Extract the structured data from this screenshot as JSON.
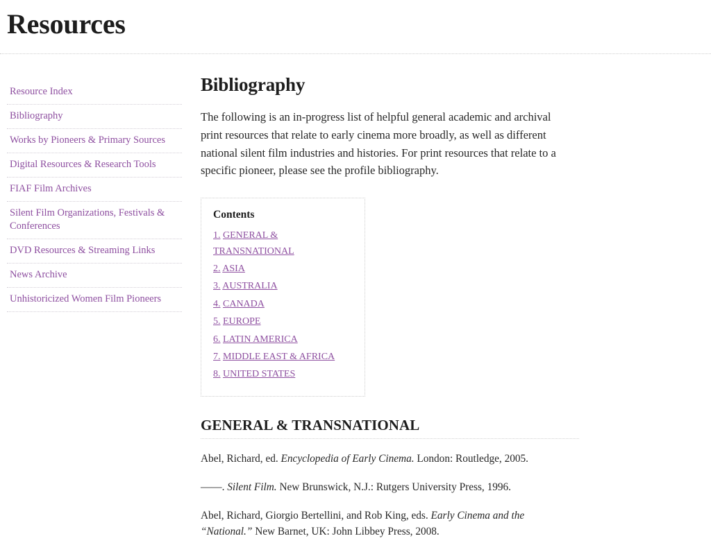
{
  "header": {
    "title": "Resources"
  },
  "sidebar": {
    "items": [
      {
        "label": "Resource Index"
      },
      {
        "label": "Bibliography"
      },
      {
        "label": "Works by Pioneers & Primary Sources"
      },
      {
        "label": "Digital Resources & Research Tools"
      },
      {
        "label": "FIAF Film Archives"
      },
      {
        "label": "Silent Film Organizations, Festivals & Conferences"
      },
      {
        "label": "DVD Resources & Streaming Links"
      },
      {
        "label": "News Archive"
      },
      {
        "label": "Unhistoricized Women Film Pioneers"
      }
    ]
  },
  "main": {
    "section_title": "Bibliography",
    "intro": "The following is an in-progress list of helpful general academic and archival print resources that relate to early cinema more broadly, as well as different national silent film industries and histories. For print resources that relate to a specific pioneer, please see the profile bibliography.",
    "contents": {
      "heading": "Contents",
      "items": [
        {
          "label": "GENERAL & TRANSNATIONAL"
        },
        {
          "label": "ASIA"
        },
        {
          "label": "AUSTRALIA"
        },
        {
          "label": "CANADA"
        },
        {
          "label": "EUROPE"
        },
        {
          "label": "LATIN AMERICA"
        },
        {
          "label": "MIDDLE EAST & AFRICA"
        },
        {
          "label": "UNITED STATES"
        }
      ]
    },
    "bibliography": {
      "heading": "GENERAL & TRANSNATIONAL",
      "entries": [
        {
          "pre": "Abel, Richard, ed. ",
          "italic": "Encyclopedia of Early Cinema.",
          "post": " London: Routledge, 2005."
        },
        {
          "pre": "——. ",
          "italic": "Silent Film.",
          "post": " New Brunswick, N.J.: Rutgers University Press, 1996."
        },
        {
          "pre": "Abel, Richard, Giorgio Bertellini, and Rob King, eds. ",
          "italic": "Early Cinema and the “National.”",
          "post": " New Barnet, UK: John Libbey Press, 2008."
        }
      ]
    }
  },
  "colors": {
    "link_purple": "#8e4fa0",
    "text_dark": "#1d1d1d",
    "body_text": "#262626",
    "divider": "#d3cdd6"
  }
}
